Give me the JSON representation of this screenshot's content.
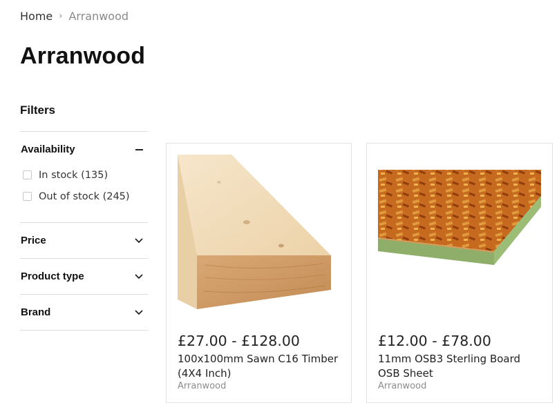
{
  "breadcrumb": {
    "home": "Home",
    "separator": "›",
    "current": "Arranwood"
  },
  "page": {
    "title": "Arranwood"
  },
  "filters": {
    "heading": "Filters",
    "groups": [
      {
        "title": "Availability",
        "expanded": true,
        "options": [
          {
            "label": "In stock (135)",
            "checked": false
          },
          {
            "label": "Out of stock (245)",
            "checked": false
          }
        ]
      },
      {
        "title": "Price",
        "expanded": false
      },
      {
        "title": "Product type",
        "expanded": false
      },
      {
        "title": "Brand",
        "expanded": false
      }
    ]
  },
  "products": [
    {
      "price": "£27.00 - £128.00",
      "title": "100x100mm Sawn C16 Timber (4X4 Inch)",
      "vendor": "Arranwood",
      "image_icon": "timber-post-image"
    },
    {
      "price": "£12.00 - £78.00",
      "title": "11mm OSB3 Sterling Board OSB Sheet",
      "vendor": "Arranwood",
      "image_icon": "osb-sheet-image"
    }
  ],
  "colors": {
    "border": "#dcdcdc",
    "text": "#222222",
    "muted": "#8a8a8a",
    "wood_light": "#f3dcb8",
    "osb_orange": "#c8691d",
    "osb_edge": "#8fae6a"
  }
}
